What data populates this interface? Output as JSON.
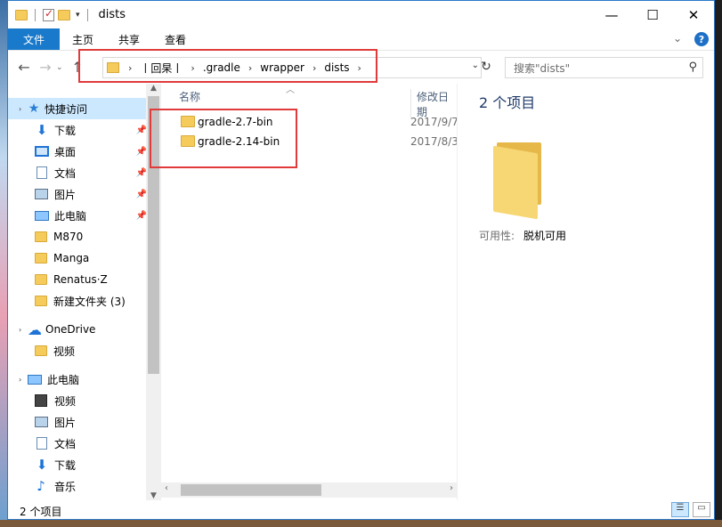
{
  "window": {
    "title": "dists",
    "controls": [
      "—",
      "☐",
      "✕"
    ]
  },
  "ribbon": {
    "tabs": [
      "文件",
      "主页",
      "共享",
      "查看"
    ],
    "collapse_chevron": "⌄",
    "help": "?"
  },
  "address": {
    "crumbs": [
      "丨回杲丨",
      ".gradle",
      "wrapper",
      "dists"
    ],
    "separator": "›"
  },
  "search": {
    "placeholder": "搜索\"dists\""
  },
  "nav": {
    "quick_access": "快捷访问",
    "items": [
      {
        "label": "下载",
        "icon": "download-icon",
        "pinned": true
      },
      {
        "label": "桌面",
        "icon": "desktop-icon",
        "pinned": true
      },
      {
        "label": "文档",
        "icon": "document-icon",
        "pinned": true
      },
      {
        "label": "图片",
        "icon": "picture-icon",
        "pinned": true
      },
      {
        "label": "此电脑",
        "icon": "computer-icon",
        "pinned": true
      },
      {
        "label": "M870",
        "icon": "folder-icon",
        "pinned": false
      },
      {
        "label": "Manga",
        "icon": "folder-icon",
        "pinned": false
      },
      {
        "label": "Renatus·Z",
        "icon": "folder-icon",
        "pinned": false
      },
      {
        "label": "新建文件夹 (3)",
        "icon": "folder-icon",
        "pinned": false
      }
    ],
    "onedrive": "OneDrive",
    "onedrive_items": [
      {
        "label": "视频",
        "icon": "folder-icon"
      }
    ],
    "this_pc": "此电脑",
    "this_pc_items": [
      {
        "label": "视频",
        "icon": "video-icon"
      },
      {
        "label": "图片",
        "icon": "picture-icon"
      },
      {
        "label": "文档",
        "icon": "document-icon"
      },
      {
        "label": "下载",
        "icon": "download-icon"
      },
      {
        "label": "音乐",
        "icon": "music-icon"
      }
    ]
  },
  "files": {
    "columns": [
      "名称",
      "修改日期"
    ],
    "rows": [
      {
        "name": "gradle-2.7-bin",
        "date": "2017/9/7"
      },
      {
        "name": "gradle-2.14-bin",
        "date": "2017/8/3"
      }
    ]
  },
  "details": {
    "count": "2 个项目",
    "availability_label": "可用性:",
    "availability_value": "脱机可用"
  },
  "status": {
    "text": "2 个项目"
  },
  "colors": {
    "accent": "#1979ca",
    "highlight": "#e03a3a",
    "folder": "#f5cc5c"
  }
}
